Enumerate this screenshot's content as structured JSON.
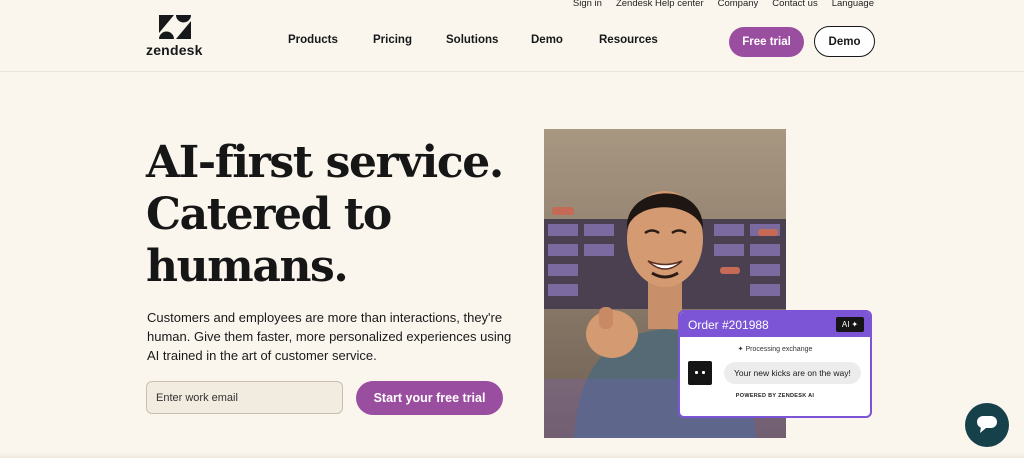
{
  "utility_nav": [
    "Sign in",
    "Zendesk Help center",
    "Company",
    "Contact us",
    "Language"
  ],
  "brand": {
    "name": "zendesk",
    "accent": "#9a4e9f",
    "dark": "#17181a",
    "background": "#faf6ee"
  },
  "nav": [
    "Products",
    "Pricing",
    "Solutions",
    "Demo",
    "Resources"
  ],
  "header_buttons": {
    "free_trial": "Free trial",
    "demo": "Demo"
  },
  "hero": {
    "title_lines": [
      "AI-first service.",
      "Catered to",
      "humans."
    ],
    "subtitle": "Customers and employees are more than interactions, they're human. Give them faster, more personalized experiences using AI trained in the art of customer service.",
    "email_placeholder": "Enter work email",
    "cta": "Start your free trial"
  },
  "chat_card": {
    "order": "Order #201988",
    "badge": "AI",
    "status": "Processing exchange",
    "message": "Your new kicks are on the way!",
    "footer": "POWERED BY ZENDESK AI",
    "accent": "#7b55d6"
  },
  "icons": {
    "logo": "zendesk-z-icon",
    "sparkle": "sparkle-icon",
    "widget": "chat-bubble-icon"
  }
}
